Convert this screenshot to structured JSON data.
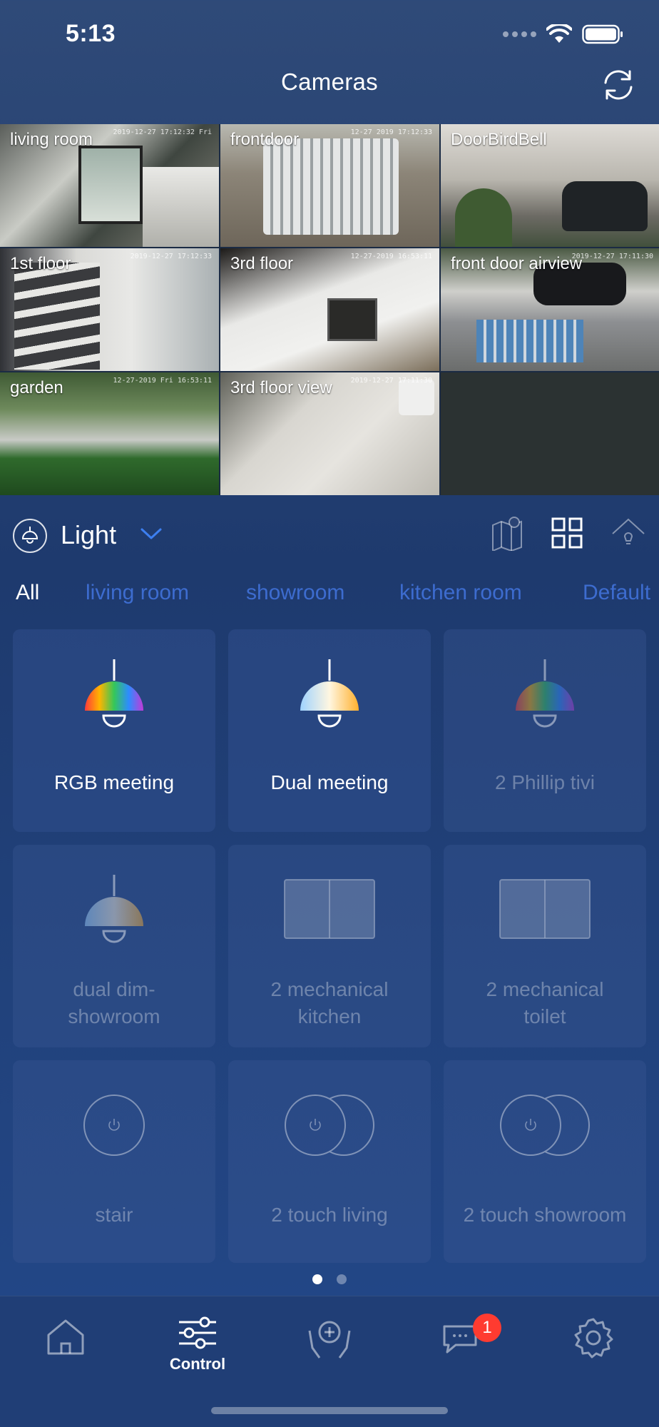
{
  "status": {
    "time": "5:13"
  },
  "header": {
    "title": "Cameras"
  },
  "cameras": [
    {
      "label": "living room",
      "timestamp": "2019-12-27 17:12:32 Fri"
    },
    {
      "label": "frontdoor",
      "timestamp": "12-27 2019 17:12:33"
    },
    {
      "label": "DoorBirdBell",
      "timestamp": ""
    },
    {
      "label": "1st floor",
      "timestamp": "2019-12-27 17:12:33"
    },
    {
      "label": "3rd floor",
      "timestamp": "12-27-2019 16:53:11"
    },
    {
      "label": "front door airview",
      "timestamp": "2019-12-27 17:11:30"
    },
    {
      "label": "garden",
      "timestamp": "12-27-2019 Fri 16:53:11"
    },
    {
      "label": "3rd floor view",
      "timestamp": "2019-12-27 17:11:30"
    }
  ],
  "category": {
    "label": "Light"
  },
  "room_tabs": [
    "All",
    "living room",
    "showroom",
    "kitchen room",
    "Default"
  ],
  "devices": [
    {
      "name": "RGB meeting",
      "type": "rgb-lamp",
      "on": true
    },
    {
      "name": "Dual meeting",
      "type": "dual-lamp",
      "on": true
    },
    {
      "name": "2 Phillip tivi",
      "type": "rgb-lamp",
      "on": false
    },
    {
      "name": "dual dim-\nshowroom",
      "type": "dual-lamp",
      "on": false
    },
    {
      "name": "2 mechanical\nkitchen",
      "type": "mechanical-switch",
      "on": false
    },
    {
      "name": "2 mechanical\ntoilet",
      "type": "mechanical-switch",
      "on": false
    },
    {
      "name": "stair",
      "type": "touch-switch",
      "on": false
    },
    {
      "name": "2 touch living",
      "type": "touch-switch-double",
      "on": false
    },
    {
      "name": "2 touch showroom",
      "type": "touch-switch-double",
      "on": false
    }
  ],
  "pager": {
    "pages": 2,
    "current": 1
  },
  "tab_bar": {
    "items": [
      {
        "name": "home",
        "label": ""
      },
      {
        "name": "control",
        "label": "Control"
      },
      {
        "name": "health",
        "label": ""
      },
      {
        "name": "messages",
        "label": ""
      },
      {
        "name": "settings",
        "label": ""
      }
    ],
    "badge": "1"
  },
  "colors": {
    "accent": "#3d6ccf",
    "badge": "#ff3b30"
  }
}
